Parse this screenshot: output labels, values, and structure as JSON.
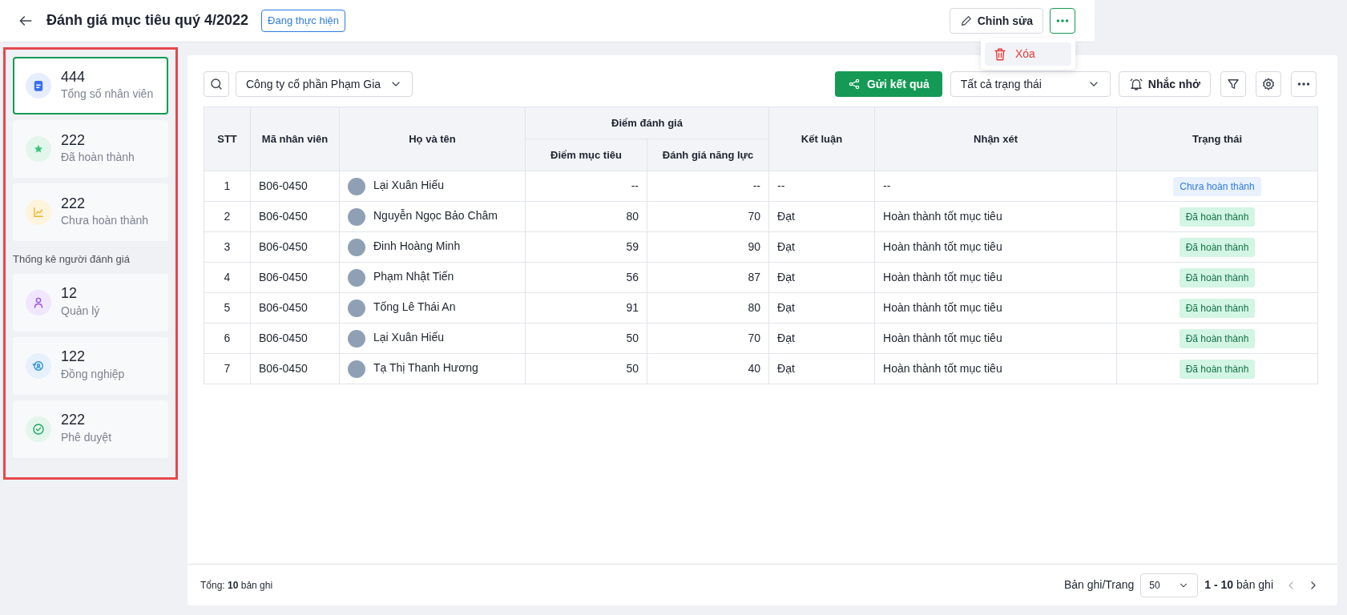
{
  "header": {
    "title": "Đánh giá mục tiêu quý 4/2022",
    "status_badge": "Đang thực hiện",
    "edit_button": "Chỉnh sửa",
    "more_menu": {
      "expanded": true,
      "items": [
        "Xóa"
      ]
    }
  },
  "sidebar": {
    "stats": [
      {
        "kind": "clipboard",
        "value": "444",
        "label": "Tổng số nhân viên",
        "selected": true
      },
      {
        "kind": "star",
        "value": "222",
        "label": "Đã hoàn thành",
        "selected": false
      },
      {
        "kind": "chart",
        "value": "222",
        "label": "Chưa hoàn thành",
        "selected": false
      }
    ],
    "section_title": "Thống kê người đánh giá",
    "reviewer_stats": [
      {
        "kind": "person",
        "value": "12",
        "label": "Quản lý",
        "selected": false
      },
      {
        "kind": "cycle",
        "value": "122",
        "label": "Đồng nghiệp",
        "selected": false
      },
      {
        "kind": "check",
        "value": "222",
        "label": "Phê duyệt",
        "selected": false
      }
    ]
  },
  "toolbar": {
    "company_select": "Công ty cổ phần Phạm Gia",
    "send_button": "Gửi kết quả",
    "status_select": "Tất cả trạng thái",
    "remind_button": "Nhắc nhở"
  },
  "table": {
    "columns": {
      "stt": "STT",
      "code": "Mã nhân viên",
      "name": "Họ và tên",
      "score_group": "Điểm đánh giá",
      "goal_score": "Điểm mục tiêu",
      "competency": "Đánh giá năng lực",
      "conclusion": "Kết luận",
      "comment": "Nhận xét",
      "status": "Trạng thái"
    },
    "rows": [
      {
        "stt": "1",
        "code": "B06-0450",
        "name": "Lại Xuân Hiếu",
        "goal_score": "--",
        "competency": "--",
        "conclusion": "--",
        "comment": "--",
        "status": "Chưa hoàn thành",
        "kind": "pending"
      },
      {
        "stt": "2",
        "code": "B06-0450",
        "name": "Nguyễn Ngọc Bảo Châm",
        "goal_score": "80",
        "competency": "70",
        "conclusion": "Đạt",
        "comment": "Hoàn thành tốt mục tiêu",
        "status": "Đã hoàn thành",
        "kind": "done"
      },
      {
        "stt": "3",
        "code": "B06-0450",
        "name": "Đinh Hoàng Minh",
        "goal_score": "59",
        "competency": "90",
        "conclusion": "Đạt",
        "comment": "Hoàn thành tốt mục tiêu",
        "status": "Đã hoàn thành",
        "kind": "done"
      },
      {
        "stt": "4",
        "code": "B06-0450",
        "name": "Phạm Nhật Tiến",
        "goal_score": "56",
        "competency": "87",
        "conclusion": "Đạt",
        "comment": "Hoàn thành tốt mục tiêu",
        "status": "Đã hoàn thành",
        "kind": "done"
      },
      {
        "stt": "5",
        "code": "B06-0450",
        "name": "Tống Lê Thái An",
        "goal_score": "91",
        "competency": "80",
        "conclusion": "Đạt",
        "comment": "Hoàn thành tốt mục tiêu",
        "status": "Đã hoàn thành",
        "kind": "done"
      },
      {
        "stt": "6",
        "code": "B06-0450",
        "name": "Lại Xuân Hiếu",
        "goal_score": "50",
        "competency": "70",
        "conclusion": "Đạt",
        "comment": "Hoàn thành tốt mục tiêu",
        "status": "Đã hoàn thành",
        "kind": "done"
      },
      {
        "stt": "7",
        "code": "B06-0450",
        "name": "Tạ Thị Thanh Hương",
        "goal_score": "50",
        "competency": "40",
        "conclusion": "Đạt",
        "comment": "Hoàn thành tốt mục tiêu",
        "status": "Đã hoàn thành",
        "kind": "done"
      }
    ]
  },
  "footer": {
    "total": "Tổng: **10** bản ghi",
    "per_page_label": "Bản ghi/Trang",
    "per_page": "50",
    "range": "**1 - 10** bản ghi"
  }
}
